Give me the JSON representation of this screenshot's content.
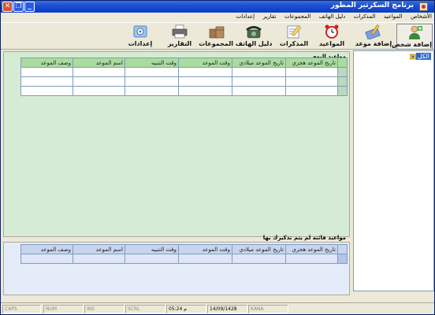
{
  "window": {
    "title": "برنامج السكرتير المطور"
  },
  "menu": [
    "الأشخاص",
    "المواعيد",
    "المذكرات",
    "دليل الهاتف",
    "المجموعات",
    "تقارير",
    "إعدادات"
  ],
  "toolbar": [
    {
      "label": "إضافة شخص",
      "icon": "add-person-icon"
    },
    {
      "label": "إضافة موعد",
      "icon": "add-appointment-icon"
    },
    {
      "label": "المواعيد",
      "icon": "alarm-clock-icon"
    },
    {
      "label": "المذكرات",
      "icon": "notes-icon"
    },
    {
      "label": "دليل الهاتف",
      "icon": "phone-icon"
    },
    {
      "label": "المجموعات",
      "icon": "groups-icon"
    },
    {
      "label": "التقارير",
      "icon": "printer-icon"
    },
    {
      "label": "إعدادات",
      "icon": "settings-icon"
    }
  ],
  "today": {
    "title": "مواعيد اليوم",
    "columns": [
      "تاريخ الموعد هجري",
      "تاريخ الموعد ميلادي",
      "وقت الموعد",
      "وقت التنبيه",
      "اسم الموعد",
      "وصف الموعد"
    ]
  },
  "missed": {
    "title": "مواعيد فائتة لم يتم تذكيرك بها",
    "columns": [
      "تاريخ الموعد هجري",
      "تاريخ الموعد ميلادي",
      "وقت الموعد",
      "وقت التنبيه",
      "اسم الموعد",
      "وصف الموعد"
    ]
  },
  "tree": {
    "root_label": "الكل"
  },
  "status": {
    "caps": "CAPS",
    "num": "NUM",
    "ins": "INS",
    "scrl": "SCRL",
    "time": "05:24 م",
    "date": "14/09/1428",
    "kana": "KANA"
  },
  "colors": {
    "titlebar": "#0a3cc0",
    "today_header": "#a9dc9d",
    "missed_header": "#c7d5f0"
  }
}
